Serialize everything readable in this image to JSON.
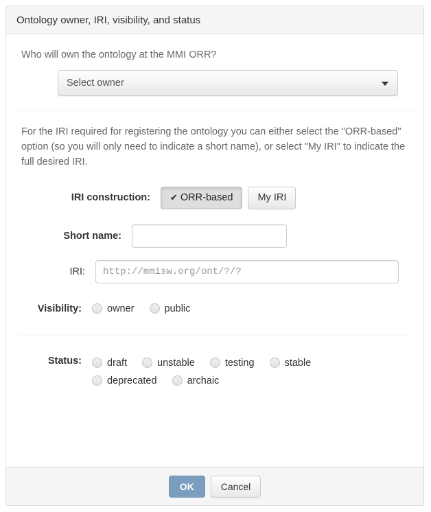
{
  "panel": {
    "title": "Ontology owner, IRI, visibility, and status"
  },
  "owner": {
    "question": "Who will own the ontology at the MMI ORR?",
    "select_value": "Select owner",
    "caret_icon": "chevron-down-icon"
  },
  "iri_info": {
    "paragraph": "For the IRI required for registering the ontology you can either select the \"ORR-based\" option (so you will only need to indicate a short name), or select \"My IRI\" to indicate the full desired IRI."
  },
  "iri_construction": {
    "label": "IRI construction:",
    "options": [
      {
        "label": "ORR-based",
        "active": true,
        "check_icon": "check-icon"
      },
      {
        "label": "My IRI",
        "active": false
      }
    ]
  },
  "short_name": {
    "label": "Short name:",
    "value": "",
    "placeholder": ""
  },
  "iri": {
    "label": "IRI:",
    "value": "",
    "placeholder": "http://mmisw.org/ont/?/?"
  },
  "visibility": {
    "label": "Visibility:",
    "options": [
      {
        "label": "owner",
        "selected": false
      },
      {
        "label": "public",
        "selected": false
      }
    ]
  },
  "status": {
    "label": "Status:",
    "options": [
      {
        "label": "draft",
        "selected": false
      },
      {
        "label": "unstable",
        "selected": false
      },
      {
        "label": "testing",
        "selected": false
      },
      {
        "label": "stable",
        "selected": false
      },
      {
        "label": "deprecated",
        "selected": false
      },
      {
        "label": "archaic",
        "selected": false
      }
    ]
  },
  "footer": {
    "ok_label": "OK",
    "cancel_label": "Cancel"
  },
  "colors": {
    "ok_button": "#7b9dbf",
    "panel_header": "#f5f5f5",
    "border": "#dddddd"
  }
}
